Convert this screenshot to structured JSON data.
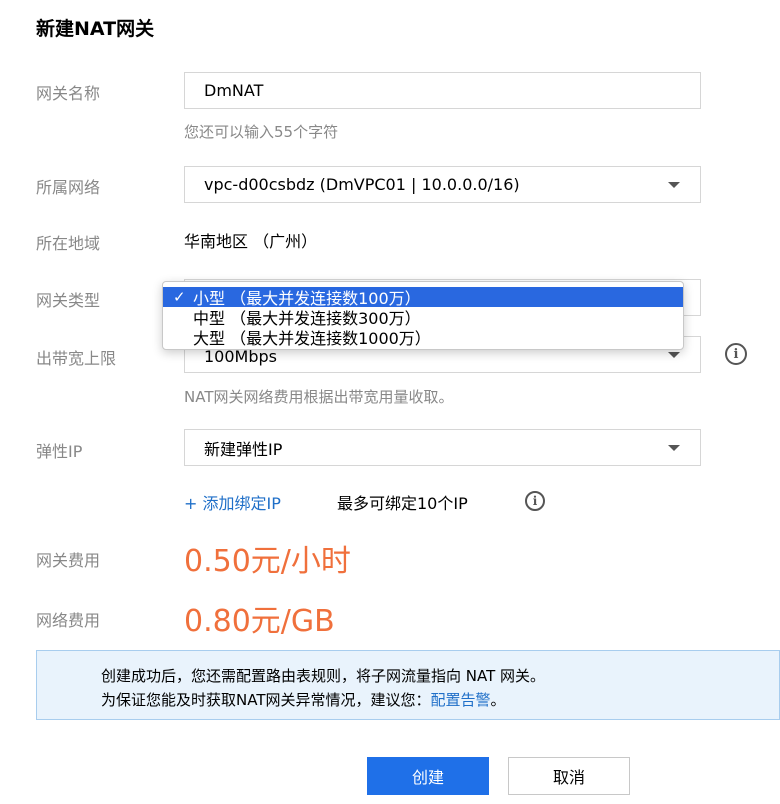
{
  "dialog": {
    "title": "新建NAT网关"
  },
  "form": {
    "name": {
      "label": "网关名称",
      "value": "DmNAT",
      "hint": "您还可以输入55个字符"
    },
    "vpc": {
      "label": "所属网络",
      "value": "vpc-d00csbdz (DmVPC01 | 10.0.0.0/16)"
    },
    "region": {
      "label": "所在地域",
      "value": "华南地区 （广州）"
    },
    "type": {
      "label": "网关类型",
      "options": [
        {
          "label": "小型 （最大并发连接数100万）",
          "selected": true
        },
        {
          "label": "中型 （最大并发连接数300万）",
          "selected": false
        },
        {
          "label": "大型 （最大并发连接数1000万）",
          "selected": false
        }
      ],
      "check_mark": "✓"
    },
    "bandwidth": {
      "label": "出带宽上限",
      "value": "100Mbps",
      "hint": "NAT网关网络费用根据出带宽用量收取。",
      "info_icon": "info-icon"
    },
    "eip": {
      "label": "弹性IP",
      "value": "新建弹性IP",
      "add_link": "+ 添加绑定IP",
      "max_text": "最多可绑定10个IP",
      "info_icon": "info-icon"
    },
    "gateway_fee": {
      "label": "网关费用",
      "value": "0.50元/小时"
    },
    "network_fee": {
      "label": "网络费用",
      "value": "0.80元/GB"
    }
  },
  "notice": {
    "line1": "创建成功后，您还需配置路由表规则，将子网流量指向 NAT 网关。",
    "line2_prefix": "为保证您能及时获取NAT网关异常情况，建议您：",
    "line2_link": "配置告警",
    "line2_suffix": "。"
  },
  "buttons": {
    "create": "创建",
    "cancel": "取消"
  },
  "colors": {
    "accent": "#1f70e8",
    "price": "#f0703c",
    "notice_bg": "#e9f3fc",
    "selected_option": "#2968e0"
  }
}
